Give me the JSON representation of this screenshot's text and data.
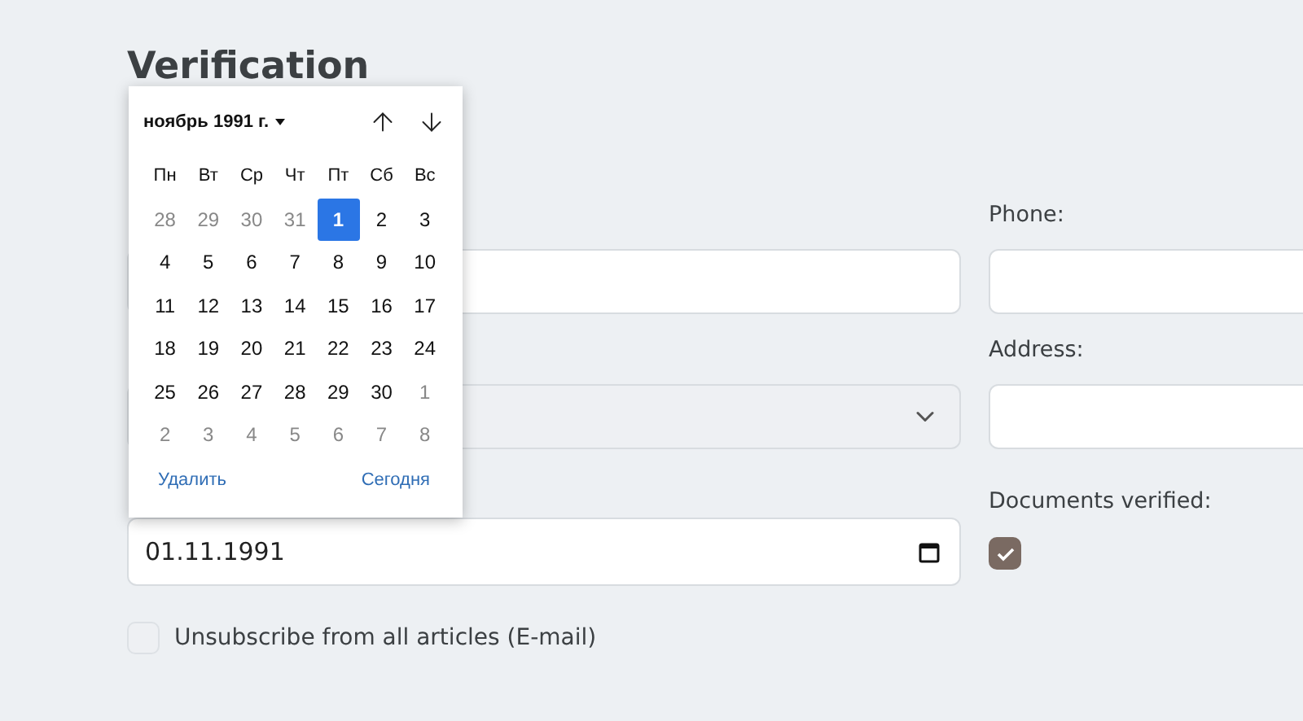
{
  "heading": "Verification",
  "left_fields": [
    {
      "kind": "text"
    },
    {
      "kind": "select"
    },
    {
      "kind": "date",
      "value": "01.11.1991"
    }
  ],
  "unsubscribe": {
    "label": "Unsubscribe from all articles (E-mail)",
    "checked": false
  },
  "right_fields": [
    {
      "kind": "text",
      "label": "Phone:"
    },
    {
      "kind": "text",
      "label": "Address:"
    },
    {
      "kind": "checkbox",
      "label": "Documents verified:",
      "checked": true
    }
  ],
  "calendar": {
    "month": "ноябрь 1991 г.",
    "weekdays": [
      "Пн",
      "Вт",
      "Ср",
      "Чт",
      "Пт",
      "Сб",
      "Вс"
    ],
    "weeks": [
      [
        {
          "day": "28",
          "muted": true,
          "selected": false
        },
        {
          "day": "29",
          "muted": true,
          "selected": false
        },
        {
          "day": "30",
          "muted": true,
          "selected": false
        },
        {
          "day": "31",
          "muted": true,
          "selected": false
        },
        {
          "day": "1",
          "muted": false,
          "selected": true
        },
        {
          "day": "2",
          "muted": false,
          "selected": false
        },
        {
          "day": "3",
          "muted": false,
          "selected": false
        }
      ],
      [
        {
          "day": "4",
          "muted": false,
          "selected": false
        },
        {
          "day": "5",
          "muted": false,
          "selected": false
        },
        {
          "day": "6",
          "muted": false,
          "selected": false
        },
        {
          "day": "7",
          "muted": false,
          "selected": false
        },
        {
          "day": "8",
          "muted": false,
          "selected": false
        },
        {
          "day": "9",
          "muted": false,
          "selected": false
        },
        {
          "day": "10",
          "muted": false,
          "selected": false
        }
      ],
      [
        {
          "day": "11",
          "muted": false,
          "selected": false
        },
        {
          "day": "12",
          "muted": false,
          "selected": false
        },
        {
          "day": "13",
          "muted": false,
          "selected": false
        },
        {
          "day": "14",
          "muted": false,
          "selected": false
        },
        {
          "day": "15",
          "muted": false,
          "selected": false
        },
        {
          "day": "16",
          "muted": false,
          "selected": false
        },
        {
          "day": "17",
          "muted": false,
          "selected": false
        }
      ],
      [
        {
          "day": "18",
          "muted": false,
          "selected": false
        },
        {
          "day": "19",
          "muted": false,
          "selected": false
        },
        {
          "day": "20",
          "muted": false,
          "selected": false
        },
        {
          "day": "21",
          "muted": false,
          "selected": false
        },
        {
          "day": "22",
          "muted": false,
          "selected": false
        },
        {
          "day": "23",
          "muted": false,
          "selected": false
        },
        {
          "day": "24",
          "muted": false,
          "selected": false
        }
      ],
      [
        {
          "day": "25",
          "muted": false,
          "selected": false
        },
        {
          "day": "26",
          "muted": false,
          "selected": false
        },
        {
          "day": "27",
          "muted": false,
          "selected": false
        },
        {
          "day": "28",
          "muted": false,
          "selected": false
        },
        {
          "day": "29",
          "muted": false,
          "selected": false
        },
        {
          "day": "30",
          "muted": false,
          "selected": false
        },
        {
          "day": "1",
          "muted": true,
          "selected": false
        }
      ],
      [
        {
          "day": "2",
          "muted": true,
          "selected": false
        },
        {
          "day": "3",
          "muted": true,
          "selected": false
        },
        {
          "day": "4",
          "muted": true,
          "selected": false
        },
        {
          "day": "5",
          "muted": true,
          "selected": false
        },
        {
          "day": "6",
          "muted": true,
          "selected": false
        },
        {
          "day": "7",
          "muted": true,
          "selected": false
        },
        {
          "day": "8",
          "muted": true,
          "selected": false
        }
      ]
    ],
    "buttons": [
      "Удалить",
      "Сегодня"
    ]
  }
}
